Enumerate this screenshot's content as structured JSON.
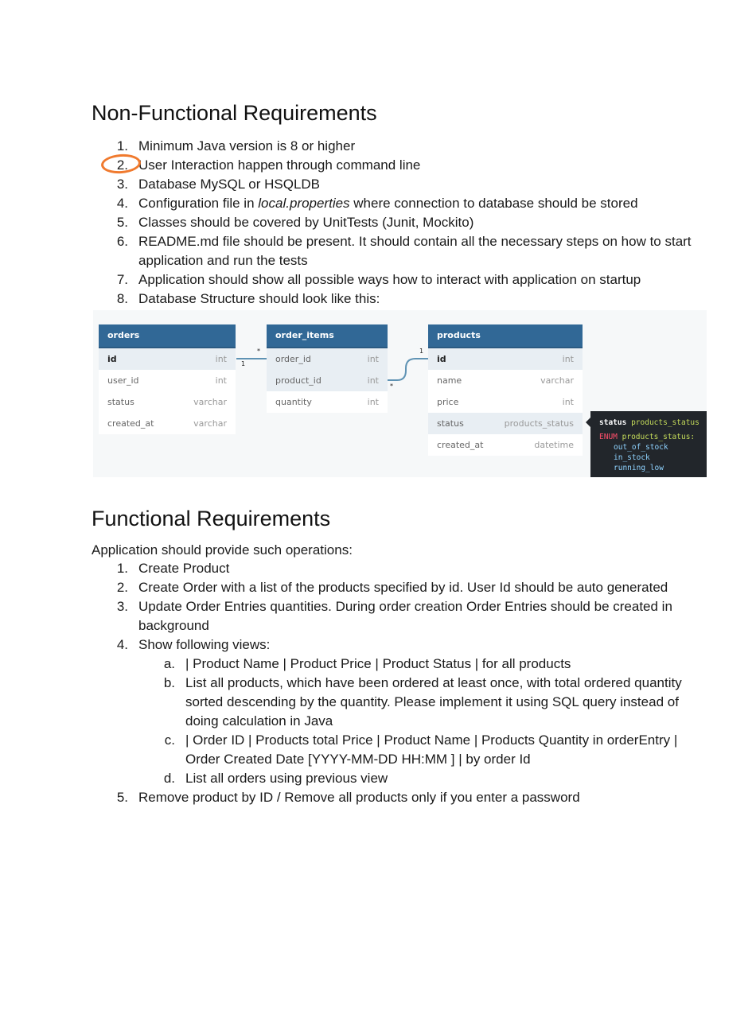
{
  "nonfunctional": {
    "heading": "Non-Functional Requirements",
    "items": [
      {
        "num": "1.",
        "text": "Minimum Java version is 8 or higher"
      },
      {
        "num": "2.",
        "text": "User Interaction happen through command line"
      },
      {
        "num": "3.",
        "text": "Database MySQL or HSQLDB"
      },
      {
        "num": "4.",
        "pre": "Configuration file in ",
        "em": "local.properties",
        "post": " where connection to database should be stored"
      },
      {
        "num": "5.",
        "text": "Classes should be covered by UnitTests (Junit, Mockito)"
      },
      {
        "num": "6.",
        "text": "README.md file should be present. It should contain all the necessary steps on how to start application and run the tests"
      },
      {
        "num": "7.",
        "text": "Application should show all possible ways how to interact with application on startup"
      },
      {
        "num": "8.",
        "text": "Database Structure should look like this:"
      }
    ]
  },
  "diagram": {
    "tables": [
      {
        "name": "orders",
        "columns": [
          {
            "name": "id",
            "type": "int"
          },
          {
            "name": "user_id",
            "type": "int"
          },
          {
            "name": "status",
            "type": "varchar"
          },
          {
            "name": "created_at",
            "type": "varchar"
          }
        ]
      },
      {
        "name": "order_items",
        "columns": [
          {
            "name": "order_id",
            "type": "int"
          },
          {
            "name": "product_id",
            "type": "int"
          },
          {
            "name": "quantity",
            "type": "int"
          }
        ]
      },
      {
        "name": "products",
        "columns": [
          {
            "name": "id",
            "type": "int"
          },
          {
            "name": "name",
            "type": "varchar"
          },
          {
            "name": "price",
            "type": "int"
          },
          {
            "name": "status",
            "type": "products_status"
          },
          {
            "name": "created_at",
            "type": "datetime"
          }
        ]
      }
    ],
    "relations": [
      {
        "one": "1",
        "many": "*"
      },
      {
        "one": "1",
        "many": "*"
      }
    ],
    "code": {
      "line1_kw": "status",
      "line1_type": "products_status",
      "line2_kw": "ENUM",
      "line2_type": "products_status:",
      "values": [
        "out_of_stock",
        "in_stock",
        "running_low"
      ]
    }
  },
  "functional": {
    "heading": "Functional Requirements",
    "intro": "Application should provide such operations:",
    "items": [
      {
        "num": "1.",
        "text": "Create Product"
      },
      {
        "num": "2.",
        "text": "Create Order with a list of the products specified by id. User Id should be auto generated"
      },
      {
        "num": "3.",
        "text": "Update Order Entries quantities. During order creation Order Entries should be created in background"
      },
      {
        "num": "4.",
        "text": "Show following views:"
      },
      {
        "num": "5.",
        "text": "Remove product by ID / Remove all products only if you enter a password"
      }
    ],
    "subitems": [
      {
        "num": "a.",
        "text": "| Product Name | Product Price | Product Status | for all products"
      },
      {
        "num": "b.",
        "text": "List all products, which have been ordered at least once, with total ordered quantity sorted descending by the quantity. Please implement it using SQL query instead of doing calculation in Java"
      },
      {
        "num": "c.",
        "text": "| Order ID | Products total Price | Product Name | Products Quantity in orderEntry | Order Created Date [YYYY-MM-DD HH:MM ] | by order Id"
      },
      {
        "num": "d.",
        "text": "List all orders using previous view"
      }
    ]
  },
  "colors": {
    "annotation_circle": "#f07a2e",
    "table_header": "#316896"
  }
}
